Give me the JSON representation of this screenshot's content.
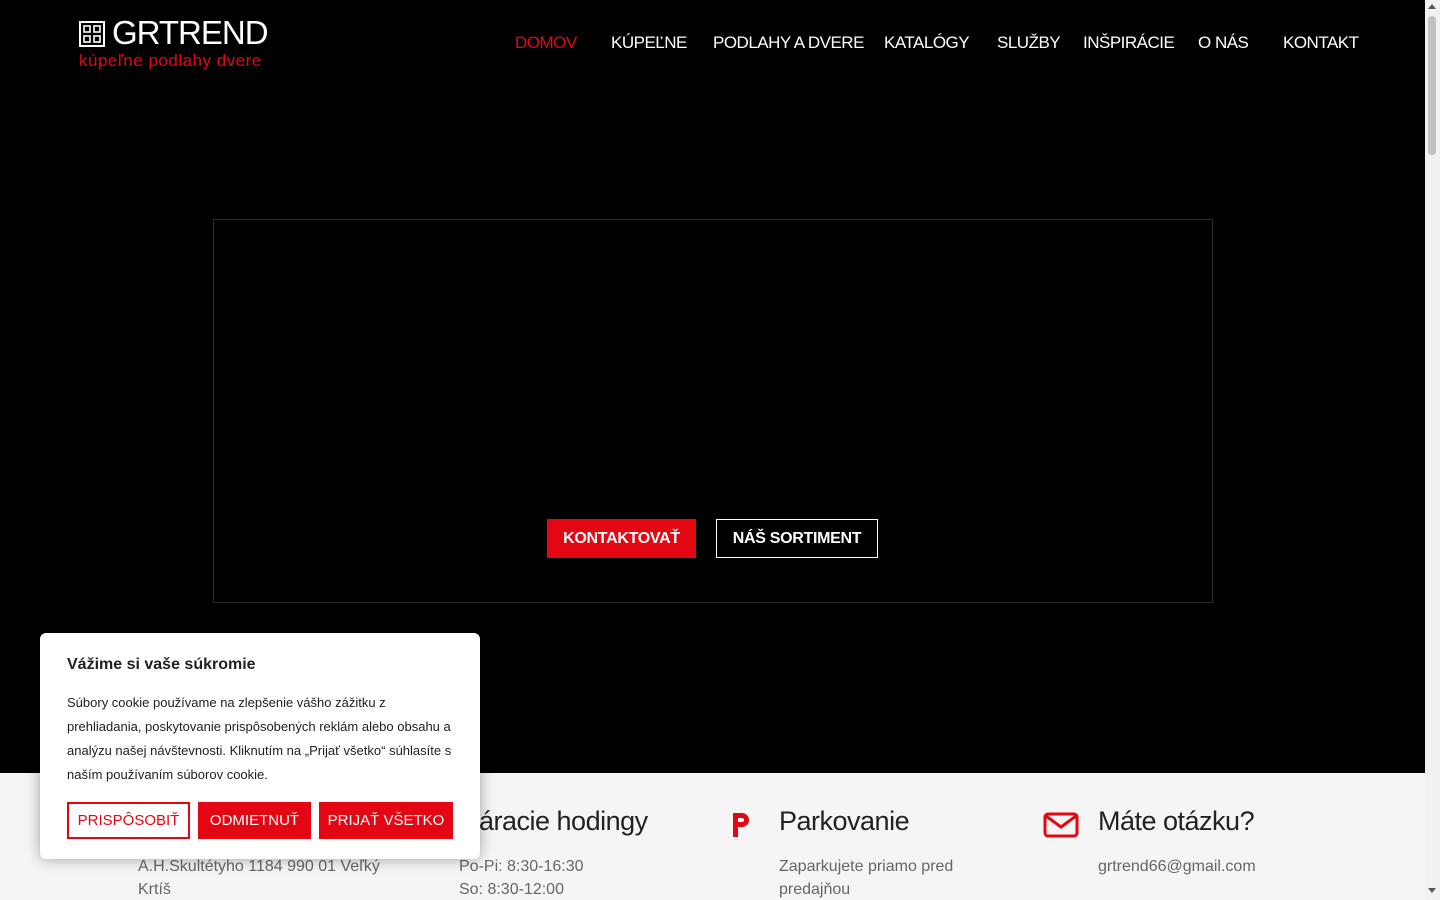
{
  "brand": {
    "name": "GRTREND",
    "tagline": "kúpeľne  podlahy  dvere",
    "accent_color": "#e30613"
  },
  "nav": {
    "items": [
      {
        "label": "DOMOV",
        "active": true
      },
      {
        "label": "KÚPEĽNE",
        "active": false
      },
      {
        "label": "PODLAHY A DVERE",
        "active": false
      },
      {
        "label": "KATALÓGY",
        "active": false
      },
      {
        "label": "SLUŽBY",
        "active": false
      },
      {
        "label": "INŠPIRÁCIE",
        "active": false
      },
      {
        "label": "O NÁS",
        "active": false
      },
      {
        "label": "KONTAKT",
        "active": false
      }
    ]
  },
  "hero": {
    "contact_button": "KONTAKTOVAŤ",
    "assortment_button": "NÁŠ SORTIMENT"
  },
  "info": {
    "address": {
      "icon": "map-pin-icon",
      "text": "A.H.Skultétyho 1184 990 01 Veľký Krtíš"
    },
    "hours": {
      "title": "tváracie hodingy",
      "lines": [
        "Po-Pi: 8:30-16:30",
        "So: 8:30-12:00"
      ]
    },
    "parking": {
      "icon": "parking-icon",
      "title": "Parkovanie",
      "text": "Zaparkujete priamo pred predajňou"
    },
    "question": {
      "icon": "envelope-icon",
      "title": "Máte otázku?",
      "email": "grtrend66@gmail.com"
    }
  },
  "cookie_banner": {
    "title": "Vážime si vaše súkromie",
    "text": "Súbory cookie používame na zlepšenie vášho zážitku z prehliadania, poskytovanie prispôsobených reklám alebo obsahu a analýzu našej návštevnosti. Kliknutím na „Prijať všetko“ súhlasíte s naším používaním súborov cookie.",
    "customize_button": "PRISPÔSOBIŤ",
    "reject_button": "ODMIETNUŤ",
    "accept_button": "PRIJAŤ VŠETKO"
  }
}
